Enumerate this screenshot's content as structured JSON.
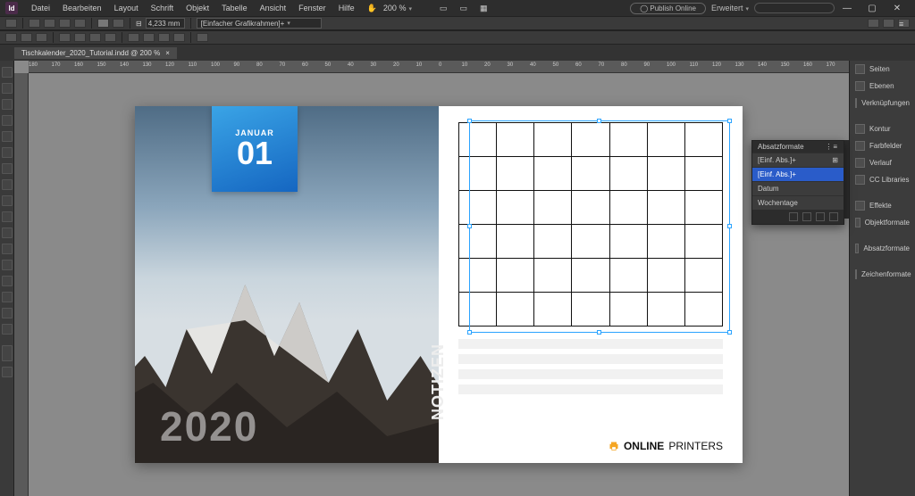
{
  "menubar": {
    "app_abbr": "Id",
    "items": [
      "Datei",
      "Bearbeiten",
      "Layout",
      "Schrift",
      "Objekt",
      "Tabelle",
      "Ansicht",
      "Fenster",
      "Hilfe"
    ],
    "zoom_value": "200 %",
    "publish_label": "Publish Online",
    "workspace": "Erweitert",
    "search_placeholder": ""
  },
  "controlbar1": {
    "field1": "4,233 mm",
    "frame_label": "[Einfacher Grafikrahmen]+"
  },
  "document_tab": {
    "title": "Tischkalender_2020_Tutorial.indd @ 200 %",
    "close": "×"
  },
  "ruler_marks_h": [
    "180",
    "170",
    "160",
    "150",
    "140",
    "130",
    "120",
    "110",
    "100",
    "90",
    "80",
    "70",
    "60",
    "50",
    "40",
    "30",
    "20",
    "10",
    "0",
    "10",
    "20",
    "30",
    "40",
    "50",
    "60",
    "70",
    "80",
    "90",
    "100",
    "110",
    "120",
    "130",
    "140",
    "150",
    "160",
    "170"
  ],
  "calendar_page": {
    "month_name": "JANUAR",
    "month_number": "01",
    "year": "2020",
    "notes_label": "NOTIZEN",
    "brand_bold": "ONLINE",
    "brand_thin": "PRINTERS",
    "grid": {
      "rows": 6,
      "cols": 7
    }
  },
  "dock": {
    "items": [
      "Seiten",
      "Ebenen",
      "Verknüpfungen",
      "",
      "Kontur",
      "Farbfelder",
      "Verlauf",
      "CC Libraries",
      "",
      "Effekte",
      "Objektformate",
      "",
      "Absatzformate",
      "",
      "Zeichenformate"
    ]
  },
  "paragraph_styles_panel": {
    "title": "Absatzformate",
    "rows": [
      {
        "label": "[Einf. Abs.]+",
        "sel": false,
        "badge": "⊞"
      },
      {
        "label": "[Einf. Abs.]+",
        "sel": true,
        "badge": ""
      },
      {
        "label": "Datum",
        "sel": false,
        "badge": ""
      },
      {
        "label": "Wochentage",
        "sel": false,
        "badge": ""
      }
    ]
  }
}
